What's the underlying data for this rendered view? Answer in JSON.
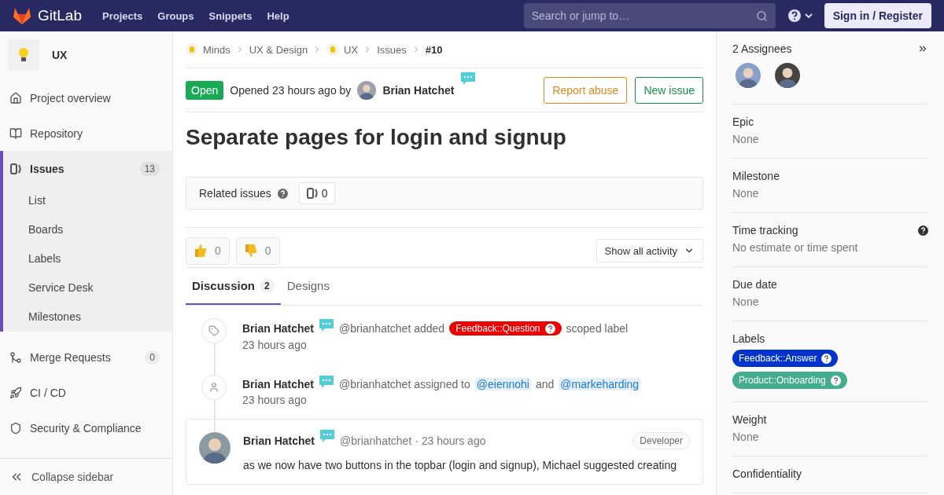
{
  "navbar": {
    "brand": "GitLab",
    "links": [
      "Projects",
      "Groups",
      "Snippets",
      "Help"
    ],
    "search": {
      "placeholder": "Search or jump to…"
    },
    "sign_in": "Sign in / Register"
  },
  "sidebar": {
    "project": "UX",
    "items": [
      {
        "label": "Project overview",
        "kind": "home",
        "selected": false
      },
      {
        "label": "Repository",
        "kind": "book",
        "selected": false
      },
      {
        "label": "Issues",
        "kind": "issues",
        "selected": true,
        "count": "13",
        "children": [
          {
            "label": "List"
          },
          {
            "label": "Boards"
          },
          {
            "label": "Labels"
          },
          {
            "label": "Service Desk"
          },
          {
            "label": "Milestones"
          }
        ]
      },
      {
        "label": "Merge Requests",
        "kind": "merge",
        "selected": false,
        "count": "0"
      },
      {
        "label": "CI / CD",
        "kind": "rocket",
        "selected": false
      },
      {
        "label": "Security & Compliance",
        "kind": "shield",
        "selected": false
      }
    ],
    "collapse": "Collapse sidebar"
  },
  "breadcrumbs": [
    {
      "label": "Minds",
      "kind": "group"
    },
    {
      "label": "UX & Design",
      "kind": "plain"
    },
    {
      "label": "UX",
      "kind": "group"
    },
    {
      "label": "Issues",
      "kind": "plain"
    },
    {
      "label": "#10",
      "kind": "current"
    }
  ],
  "issue": {
    "status": "Open",
    "opened": "Opened 23 hours ago by",
    "author": "Brian Hatchet",
    "actions": [
      {
        "label": "Report abuse",
        "kind": "warning"
      },
      {
        "label": "New issue",
        "kind": "success"
      }
    ],
    "title": "Separate pages for login and signup",
    "related": {
      "label": "Related issues",
      "count": "0"
    }
  },
  "reactions": [
    {
      "kind": "thumbsup",
      "count": "0"
    },
    {
      "kind": "thumbsdown",
      "count": "0"
    }
  ],
  "activity_filter": "Show all activity",
  "tabs": [
    {
      "label": "Discussion",
      "count": "2",
      "selected": true
    },
    {
      "label": "Designs",
      "selected": false
    }
  ],
  "timeline": [
    {
      "kind": "label",
      "author": "Brian Hatchet",
      "handle": "@brianhatchet added",
      "label": {
        "text": "Feedback::Question",
        "color": "#ee0000"
      },
      "after": "scoped label",
      "time": "23 hours ago"
    },
    {
      "kind": "assign",
      "author": "Brian Hatchet",
      "handle": "@brianhatchet assigned to",
      "mentions": [
        "@eiennohi",
        "@markeharding"
      ],
      "joiner": "and",
      "time": "23 hours ago"
    }
  ],
  "note": {
    "author": "Brian Hatchet",
    "handle": "@brianhatchet · 23 hours ago",
    "role": "Developer",
    "body": "as we now have two buttons in the topbar (login and signup), Michael suggested creating"
  },
  "right_sidebar": {
    "assignees_title": "2 Assignees",
    "sections": [
      {
        "title": "Epic",
        "value": "None"
      },
      {
        "title": "Milestone",
        "value": "None"
      },
      {
        "title": "Time tracking",
        "value": "No estimate or time spent",
        "help": true
      },
      {
        "title": "Due date",
        "value": "None"
      },
      {
        "title": "Labels",
        "labels": [
          {
            "text": "Feedback::Answer",
            "color": "#0033cc"
          },
          {
            "text": "Product::Onboarding",
            "color": "#44ad8e"
          }
        ]
      },
      {
        "title": "Weight",
        "value": "None"
      },
      {
        "title": "Confidentiality"
      }
    ]
  }
}
